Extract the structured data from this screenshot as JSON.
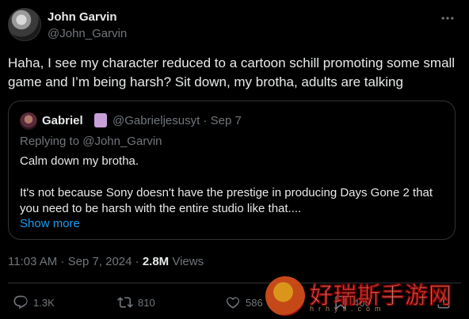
{
  "author": {
    "name": "John Garvin",
    "handle": "@John_Garvin"
  },
  "tweet": {
    "text": "Haha, I see my character reduced to a cartoon schill promoting some small game and I’m being harsh? Sit down, my brotha, adults are talking"
  },
  "quote": {
    "name": "Gabriel",
    "handle_date": "@Gabrieljesusyt · Sep 7",
    "replying_to": "Replying to @John_Garvin",
    "body_line1": "Calm down my brotha.",
    "body_line2": "It's not because Sony doesn't have the prestige in producing Days Gone 2 that you need to be harsh with the entire studio like that....",
    "show_more": "Show more"
  },
  "meta": {
    "timestamp": "11:03 AM · Sep 7, 2024 · ",
    "views_count": "2.8M",
    "views_label": " Views"
  },
  "actions": {
    "replies": "1.3K",
    "reposts": "810",
    "likes": "586",
    "bookmarks": "400"
  },
  "watermark": {
    "text": "好瑞斯手游网",
    "url": "hrhys.com"
  },
  "colors": {
    "background": "#000000",
    "text_primary": "#e7e9ea",
    "text_secondary": "#71767b",
    "link": "#1d9bf0",
    "border": "#2f3336"
  },
  "icons": {
    "more": "more-horizontal-icon",
    "reply": "reply-bubble-icon",
    "repost": "repost-icon",
    "like": "heart-icon",
    "bookmark": "bookmark-icon",
    "share": "share-icon"
  }
}
